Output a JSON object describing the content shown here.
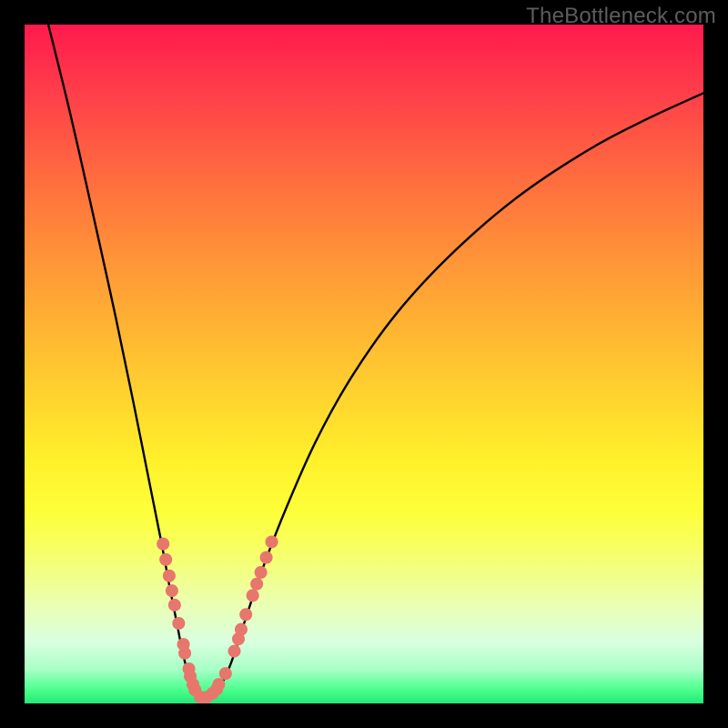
{
  "watermark": "TheBottleneck.com",
  "colors": {
    "frame": "#000000",
    "gradient_top": "#ff1a4d",
    "gradient_bottom": "#24e874",
    "curve": "#000000",
    "marker": "#e7766d"
  },
  "chart_data": {
    "type": "line",
    "title": "",
    "xlabel": "",
    "ylabel": "",
    "xlim": [
      0,
      100
    ],
    "ylim": [
      0,
      100
    ],
    "grid": false,
    "series": [
      {
        "name": "curve-left",
        "points": [
          {
            "x": 3.5,
            "y": 100
          },
          {
            "x": 6.7,
            "y": 87
          },
          {
            "x": 10.1,
            "y": 72
          },
          {
            "x": 13.4,
            "y": 57
          },
          {
            "x": 16.1,
            "y": 44
          },
          {
            "x": 18.1,
            "y": 34
          },
          {
            "x": 20.1,
            "y": 24
          },
          {
            "x": 21.4,
            "y": 17
          },
          {
            "x": 22.4,
            "y": 12
          },
          {
            "x": 23.4,
            "y": 7
          },
          {
            "x": 24.4,
            "y": 3.5
          },
          {
            "x": 25.4,
            "y": 1.6
          },
          {
            "x": 26.4,
            "y": 0.9
          }
        ]
      },
      {
        "name": "curve-right",
        "points": [
          {
            "x": 26.4,
            "y": 0.9
          },
          {
            "x": 28.2,
            "y": 1.6
          },
          {
            "x": 30.2,
            "y": 5.4
          },
          {
            "x": 32.2,
            "y": 11.4
          },
          {
            "x": 34.9,
            "y": 19.4
          },
          {
            "x": 38.3,
            "y": 28.2
          },
          {
            "x": 42.9,
            "y": 38.6
          },
          {
            "x": 48.3,
            "y": 48.3
          },
          {
            "x": 55.0,
            "y": 57.7
          },
          {
            "x": 63.1,
            "y": 66.4
          },
          {
            "x": 72.5,
            "y": 74.5
          },
          {
            "x": 82.5,
            "y": 81.2
          },
          {
            "x": 91.3,
            "y": 85.9
          },
          {
            "x": 100.0,
            "y": 89.9
          }
        ]
      }
    ],
    "markers": {
      "name": "pink-dots",
      "color": "#e7766d",
      "radius_percent": 0.94,
      "points": [
        {
          "x": 20.4,
          "y": 23.5
        },
        {
          "x": 20.8,
          "y": 21.2
        },
        {
          "x": 21.3,
          "y": 18.8
        },
        {
          "x": 21.7,
          "y": 16.6
        },
        {
          "x": 22.1,
          "y": 14.5
        },
        {
          "x": 22.7,
          "y": 11.8
        },
        {
          "x": 23.4,
          "y": 8.7
        },
        {
          "x": 23.6,
          "y": 7.4
        },
        {
          "x": 24.2,
          "y": 5.1
        },
        {
          "x": 24.4,
          "y": 4.0
        },
        {
          "x": 24.8,
          "y": 2.8
        },
        {
          "x": 25.1,
          "y": 2.0
        },
        {
          "x": 25.9,
          "y": 0.9
        },
        {
          "x": 26.8,
          "y": 0.9
        },
        {
          "x": 27.7,
          "y": 1.5
        },
        {
          "x": 28.3,
          "y": 2.1
        },
        {
          "x": 28.6,
          "y": 2.8
        },
        {
          "x": 29.6,
          "y": 4.4
        },
        {
          "x": 30.9,
          "y": 7.7
        },
        {
          "x": 31.5,
          "y": 9.5
        },
        {
          "x": 31.9,
          "y": 10.9
        },
        {
          "x": 32.6,
          "y": 13.1
        },
        {
          "x": 33.6,
          "y": 15.9
        },
        {
          "x": 34.2,
          "y": 17.6
        },
        {
          "x": 34.8,
          "y": 19.3
        },
        {
          "x": 35.6,
          "y": 21.5
        },
        {
          "x": 36.4,
          "y": 23.8
        }
      ]
    }
  }
}
